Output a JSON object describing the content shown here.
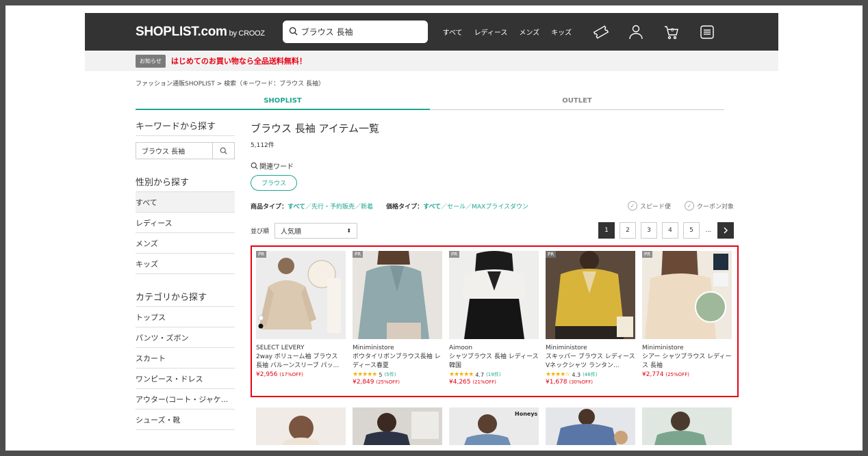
{
  "header": {
    "logo": "SHOPLIST.com",
    "logo_sub": "by CROOZ",
    "search_value": "ブラウス 長袖",
    "nav": [
      "すべて",
      "レディース",
      "メンズ",
      "キッズ"
    ]
  },
  "notice": {
    "tag": "お知らせ",
    "message": "はじめてのお買い物なら全品送料無料！"
  },
  "breadcrumb": "ファッション通販SHOPLIST > 検索（キーワード：ブラウス 長袖）",
  "tabs": [
    {
      "label": "SHOPLIST",
      "active": true
    },
    {
      "label": "OUTLET",
      "active": false
    }
  ],
  "sidebar": {
    "keyword_heading": "キーワードから探す",
    "keyword_value": "ブラウス 長袖",
    "gender_heading": "性別から探す",
    "genders": [
      "すべて",
      "レディース",
      "メンズ",
      "キッズ"
    ],
    "category_heading": "カテゴリから探す",
    "categories": [
      "トップス",
      "パンツ・ズボン",
      "スカート",
      "ワンピース・ドレス",
      "アウター(コート・ジャケ...",
      "シューズ・靴"
    ]
  },
  "main": {
    "title": "ブラウス 長袖 アイテム一覧",
    "count": "5,112件",
    "related_label": "関連ワード",
    "related_chip": "ブラウス",
    "product_type_label": "商品タイプ：",
    "product_types": [
      "すべて",
      "先行・予約販売",
      "新着"
    ],
    "price_type_label": "価格タイプ：",
    "price_types": [
      "すべて",
      "セール",
      "MAXプライスダウン"
    ],
    "sep": "／",
    "check_speed": "スピード便",
    "check_coupon": "クーポン対象",
    "sort_label": "並び順",
    "sort_value": "人気順",
    "pages": [
      "1",
      "2",
      "3",
      "4",
      "5"
    ],
    "ellipsis": "...",
    "current_page": "1"
  },
  "products": [
    {
      "brand": "SELECT LEVERY",
      "name": "2way ボリューム袖 ブラウス 長袖 バルーンスリーブ パッ...",
      "rating": "",
      "reviews": "",
      "price": "¥2,956",
      "off": "(17%OFF)",
      "badge": "PR"
    },
    {
      "brand": "Miniministore",
      "name": "ボウタイリボンブラウス長袖 レディース春夏",
      "rating": "5",
      "stars": 5,
      "reviews": "(5件)",
      "price": "¥2,849",
      "off": "(25%OFF)",
      "badge": "PR"
    },
    {
      "brand": "Aimoon",
      "name": "シャツブラウス 長袖 レディース 韓国",
      "rating": "4.7",
      "stars": 5,
      "reviews": "(19件)",
      "price": "¥4,265",
      "off": "(21%OFF)",
      "badge": "PR"
    },
    {
      "brand": "Miniministore",
      "name": "スキッパー ブラウス レディース Vネックシャツ ランタン...",
      "rating": "4.3",
      "stars": 4,
      "reviews": "(46件)",
      "price": "¥1,678",
      "off": "(30%OFF)",
      "badge": "PR"
    },
    {
      "brand": "Miniministore",
      "name": "シアー シャツブラウス レディース 長袖",
      "rating": "",
      "reviews": "",
      "price": "¥2,774",
      "off": "(25%OFF)",
      "badge": "PR"
    }
  ],
  "colors": {
    "accent": "#1fa591",
    "sale": "#e60012",
    "header": "#333333"
  }
}
